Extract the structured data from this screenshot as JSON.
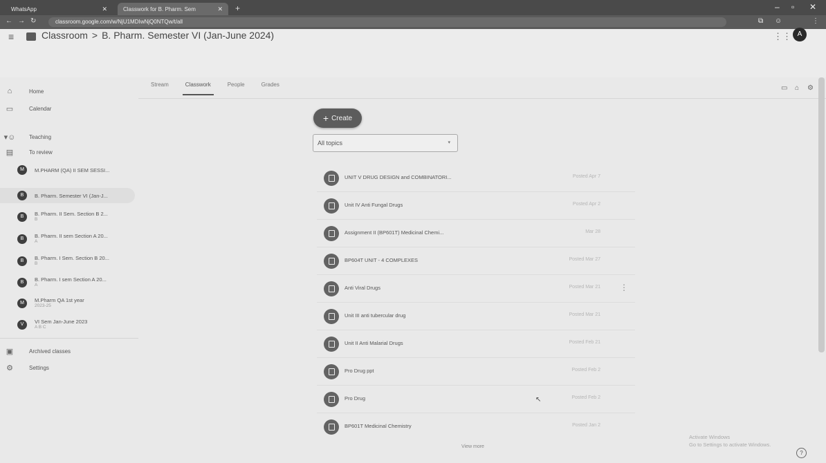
{
  "browser": {
    "tabs": [
      {
        "label": "WhatsApp"
      },
      {
        "label": "Classwork for B. Pharm. Sem"
      }
    ],
    "url": "classroom.google.com/w/NjU1MDIwNjQ0NTQw/t/all"
  },
  "header": {
    "app_name": "Classroom",
    "separator": ">",
    "class_name": "B. Pharm. Semester VI (Jan-June 2024)",
    "avatar_letter": "A"
  },
  "tabs": [
    "Stream",
    "Classwork",
    "People",
    "Grades"
  ],
  "sidebar": {
    "home": "Home",
    "calendar": "Calendar",
    "teaching": "Teaching",
    "to_review": "To review",
    "classes": [
      {
        "initial": "M",
        "name": "M.PHARM (QA) II SEM SESSI...",
        "sub": ""
      },
      {
        "initial": "B",
        "name": "B. Pharm. Semester VI (Jan-J...",
        "sub": ""
      },
      {
        "initial": "B",
        "name": "B. Pharm. II Sem. Section B 2...",
        "sub": "B"
      },
      {
        "initial": "B",
        "name": "B. Pharm. II sem Section A 20...",
        "sub": "A"
      },
      {
        "initial": "B",
        "name": "B. Pharm. I Sem. Section B 20...",
        "sub": "B"
      },
      {
        "initial": "B",
        "name": "B. Pharm. I sem Section A 20...",
        "sub": "A"
      },
      {
        "initial": "M",
        "name": "M.Pharm QA 1st year",
        "sub": "2023-25"
      },
      {
        "initial": "V",
        "name": "VI Sem Jan-June 2023",
        "sub": "A B C"
      }
    ],
    "archived": "Archived classes",
    "settings": "Settings"
  },
  "main": {
    "create_label": "Create",
    "topic_filter": "All topics",
    "assignments": [
      {
        "title": "UNIT V DRUG DESIGN and COMBINATORI...",
        "date": "Posted Apr 7"
      },
      {
        "title": "Unit IV Anti Fungal Drugs",
        "date": "Posted Apr 2"
      },
      {
        "title": "Assignment II (BP601T) Medicinal Chemi...",
        "date": "Mar 28"
      },
      {
        "title": "BP604T UNIT - 4 COMPLEXES",
        "date": "Posted Mar 27"
      },
      {
        "title": "Anti Viral Drugs",
        "date": "Posted Mar 21"
      },
      {
        "title": "Unit III anti tubercular drug",
        "date": "Posted Mar 21"
      },
      {
        "title": "Unit II Anti Malarial Drugs",
        "date": "Posted Feb 21"
      },
      {
        "title": "Pro Drug ppt",
        "date": "Posted Feb 2"
      },
      {
        "title": "Pro Drug",
        "date": "Posted Feb 2"
      },
      {
        "title": "BP601T Medicinal Chemistry",
        "date": "Posted Jan 2"
      }
    ],
    "view_more": "View more"
  },
  "watermark": {
    "line1": "Activate Windows",
    "line2": "Go to Settings to activate Windows."
  },
  "icons": {
    "help": "?"
  }
}
